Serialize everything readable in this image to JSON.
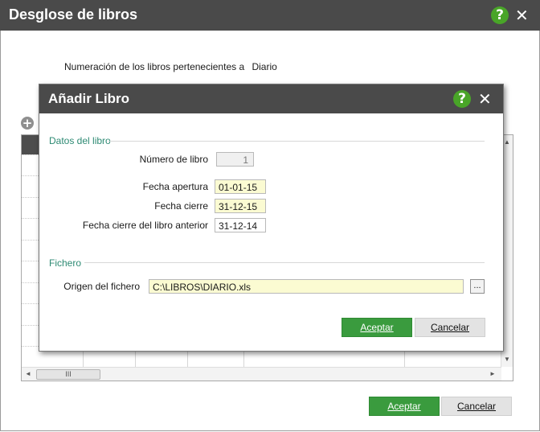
{
  "window": {
    "title": "Desglose de libros",
    "help_icon": "?",
    "close_icon": "✕",
    "numeracion_label": "Numeración de los libros pertenecientes a",
    "numeracion_value": "Diario",
    "add_icon": "+",
    "accept_label": "Aceptar",
    "cancel_label": "Cancelar"
  },
  "grid": {
    "scroll_up": "▲",
    "scroll_down": "▼",
    "scroll_left": "◄",
    "scroll_right": "►",
    "thumb_grip": "III"
  },
  "dialog": {
    "title": "Añadir Libro",
    "help_icon": "?",
    "close_icon": "✕",
    "section_book": "Datos del libro",
    "numero_label": "Número de libro",
    "numero_value": "1",
    "apertura_label": "Fecha apertura",
    "apertura_value": "01-01-15",
    "cierre_label": "Fecha cierre",
    "cierre_value": "31-12-15",
    "cierre_anterior_label": "Fecha cierre del libro anterior",
    "cierre_anterior_value": "31-12-14",
    "section_file": "Fichero",
    "origen_label": "Origen del fichero",
    "origen_value": "C:\\LIBROS\\DIARIO.xls",
    "browse_label": "...",
    "accept_label": "Aceptar",
    "cancel_label": "Cancelar"
  },
  "colors": {
    "titlebar": "#4a4a4a",
    "accent_green": "#3a9b3e",
    "section_teal": "#2d8a73",
    "field_yellow": "#fbfbd2"
  }
}
